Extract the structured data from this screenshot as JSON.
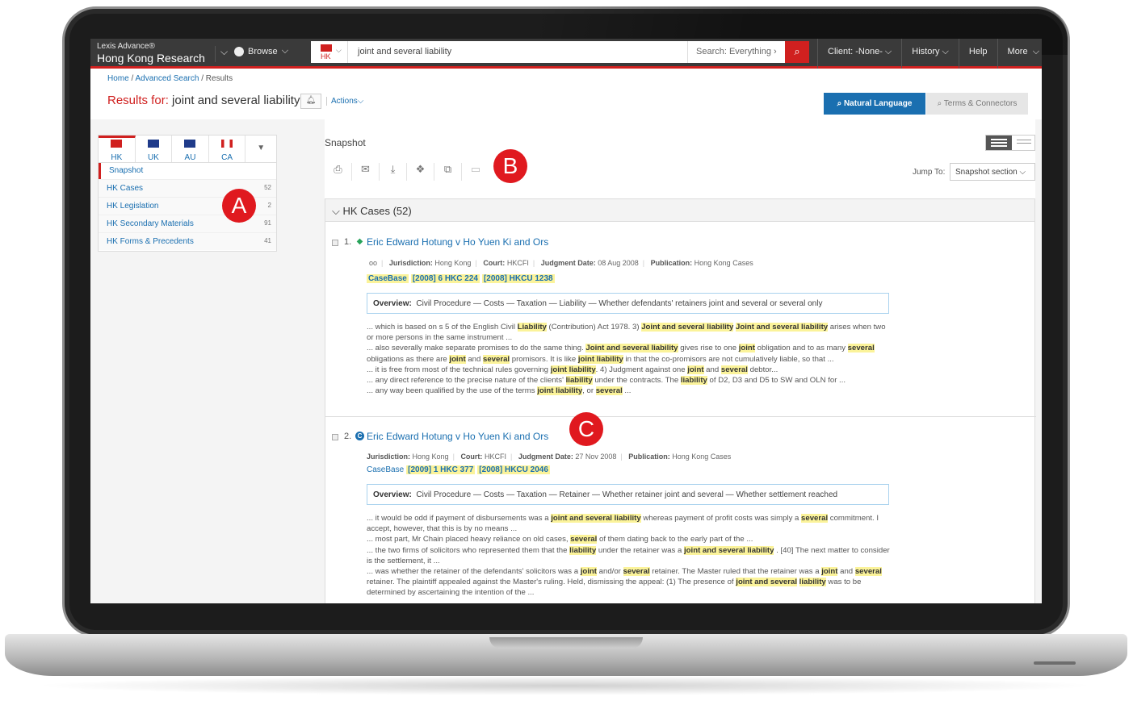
{
  "topbar": {
    "brand_line1": "Lexis Advance®",
    "brand_line2": "Hong Kong Research",
    "browse_label": "Browse",
    "jurisdiction_code": "HK",
    "search_query": "joint and several liability",
    "search_scope": "Search: Everything",
    "nav": [
      "Client: -None-",
      "History",
      "Help",
      "More"
    ]
  },
  "breadcrumb": {
    "home": "Home",
    "advanced": "Advanced Search",
    "current": "Results"
  },
  "results_header": {
    "label": "Results for:",
    "query": "joint and several liability",
    "actions": "Actions"
  },
  "search_modes": {
    "natural": "Natural Language",
    "terms": "Terms & Connectors"
  },
  "sidebar": {
    "tabs": [
      {
        "label": "HK",
        "color": "#d0201f"
      },
      {
        "label": "UK",
        "color": "#1f3b8a"
      },
      {
        "label": "AU",
        "color": "#1f3b8a"
      },
      {
        "label": "CA",
        "color": "#d0201f"
      }
    ],
    "snapshot": "Snapshot",
    "items": [
      {
        "label": "HK Cases",
        "count": "52"
      },
      {
        "label": "HK Legislation",
        "count": "2"
      },
      {
        "label": "HK Secondary Materials",
        "count": "91"
      },
      {
        "label": "HK Forms & Precedents",
        "count": "41"
      }
    ]
  },
  "main": {
    "title": "Snapshot",
    "jump_label": "Jump To:",
    "jump_value": "Snapshot section",
    "section_heading": "HK Cases (52)"
  },
  "results": [
    {
      "num": "1.",
      "title": "Eric Edward Hotung v Ho Yuen Ki and Ors",
      "jurisdiction": "Hong Kong",
      "court": "HKCFI",
      "judgment_date": "08 Aug 2008",
      "publication": "Hong Kong Cases",
      "casebase": "CaseBase",
      "citations": [
        "[2008] 6 HKC 224",
        "[2008] HKCU 1238"
      ],
      "overview": "Civil Procedure — Costs — Taxation — Liability — Whether defendants' retainers joint and several or several only"
    },
    {
      "num": "2.",
      "title": "Eric Edward Hotung v Ho Yuen Ki and Ors",
      "jurisdiction": "Hong Kong",
      "court": "HKCFI",
      "judgment_date": "27 Nov 2008",
      "publication": "Hong Kong Cases",
      "casebase": "CaseBase",
      "citations": [
        "[2009] 1 HKC 377",
        "[2008] HKCU 2046"
      ],
      "overview": "Civil Procedure — Costs — Taxation — Retainer — Whether retainer joint and several — Whether settlement reached"
    }
  ],
  "meta_labels": {
    "jurisdiction": "Jurisdiction:",
    "court": "Court:",
    "judgment_date": "Judgment Date:",
    "publication": "Publication:",
    "overview": "Overview:"
  },
  "callouts": {
    "a": "A",
    "b": "B",
    "c": "C"
  },
  "colors": {
    "accent": "#d0201f",
    "link": "#1a6fb0",
    "highlight": "#fbf39a",
    "topbar": "#3a3a3a"
  },
  "icons": [
    "print-icon",
    "email-icon",
    "download-icon",
    "dropbox-icon",
    "copy-icon",
    "document-icon",
    "bell-icon",
    "search-icon",
    "globe-icon",
    "view-list-icon"
  ]
}
